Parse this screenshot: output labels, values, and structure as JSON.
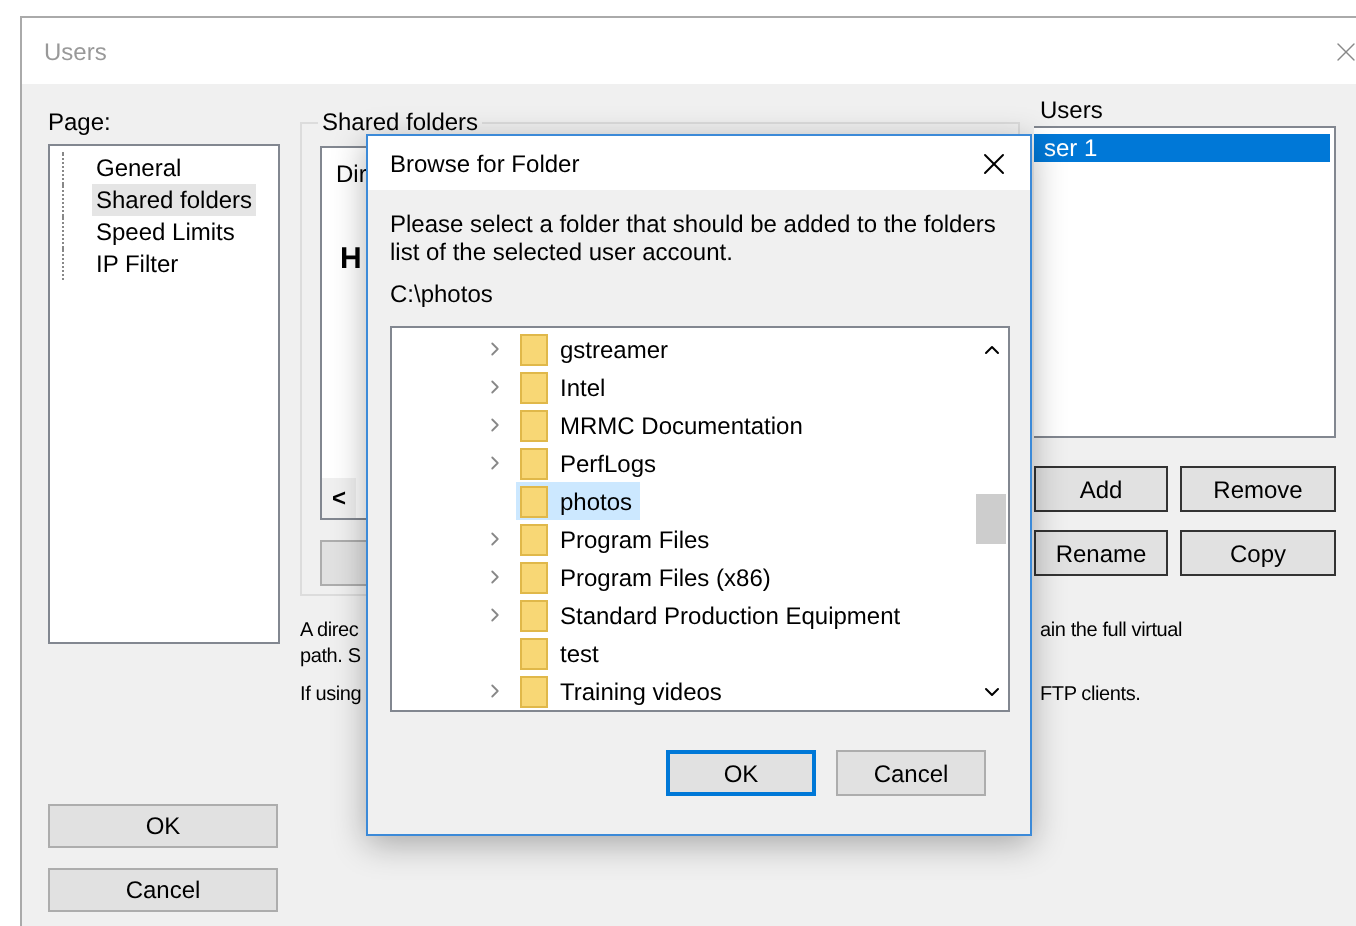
{
  "window": {
    "title": "Users"
  },
  "page_panel": {
    "label": "Page:",
    "items": [
      {
        "label": "General",
        "selected": false
      },
      {
        "label": "Shared folders",
        "selected": true
      },
      {
        "label": "Speed Limits",
        "selected": false
      },
      {
        "label": "IP Filter",
        "selected": false
      }
    ]
  },
  "shared_folders": {
    "label": "Shared folders",
    "column_1": "Dir",
    "text_1": "H",
    "scroll_left": "<"
  },
  "notes": [
    {
      "left": "A direc",
      "right": "ain the full virtual"
    },
    {
      "left": "path. S"
    },
    {
      "left": "If using",
      "right": "FTP clients."
    }
  ],
  "users": {
    "label": "Users",
    "items": [
      {
        "label": "ser 1",
        "selected": true
      }
    ],
    "buttons": [
      {
        "label": "Add"
      },
      {
        "label": "Remove"
      },
      {
        "label": "Rename"
      },
      {
        "label": "Copy"
      }
    ]
  },
  "main_buttons": [
    {
      "label": "OK"
    },
    {
      "label": "Cancel"
    }
  ],
  "dialog": {
    "title": "Browse for Folder",
    "message": "Please select a folder that should be added to the folders list of the selected user account.",
    "path": "C:\\photos",
    "folders": [
      {
        "label": "gstreamer",
        "expandable": true,
        "selected": false
      },
      {
        "label": "Intel",
        "expandable": true,
        "selected": false
      },
      {
        "label": "MRMC Documentation",
        "expandable": true,
        "selected": false
      },
      {
        "label": "PerfLogs",
        "expandable": true,
        "selected": false
      },
      {
        "label": "photos",
        "expandable": false,
        "selected": true
      },
      {
        "label": "Program Files",
        "expandable": true,
        "selected": false
      },
      {
        "label": "Program Files (x86)",
        "expandable": true,
        "selected": false
      },
      {
        "label": "Standard Production Equipment",
        "expandable": true,
        "selected": false
      },
      {
        "label": "test",
        "expandable": false,
        "selected": false
      },
      {
        "label": "Training videos",
        "expandable": true,
        "selected": false
      }
    ],
    "buttons": [
      {
        "label": "OK",
        "default": true
      },
      {
        "label": "Cancel",
        "default": false
      }
    ]
  }
}
